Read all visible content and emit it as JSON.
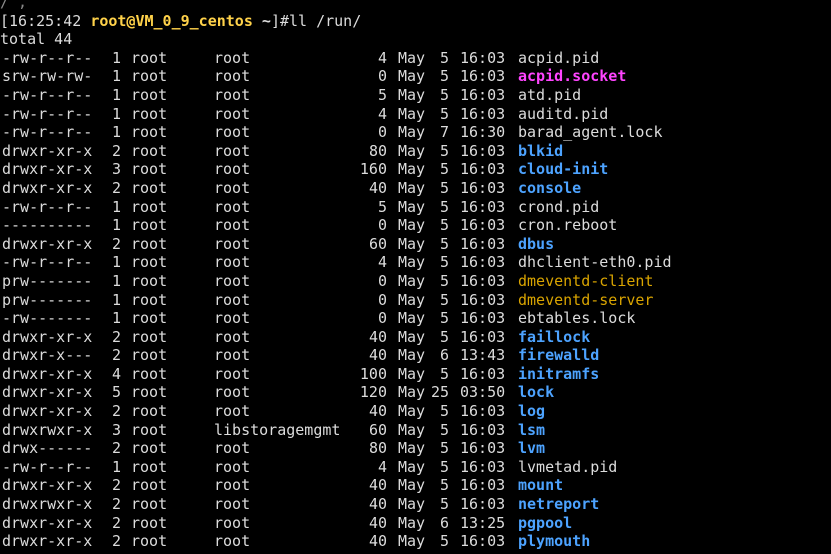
{
  "terminal": {
    "cut_line": "​/ ,",
    "prompt": {
      "open_bracket": "[",
      "time": "16:25:42",
      "user_host": "root@VM_0_9_centos",
      "cwd": " ~",
      "close_bracket": "]",
      "command": "#ll /run/"
    },
    "total_line": "total 44",
    "entries": [
      {
        "perm": "-rw-r--r--",
        "links": "1",
        "owner": "root",
        "group": "root",
        "size": "4",
        "month": "May",
        "day": "5",
        "time": "16:03",
        "name": "acpid.pid",
        "kind": "file"
      },
      {
        "perm": "srw-rw-rw-",
        "links": "1",
        "owner": "root",
        "group": "root",
        "size": "0",
        "month": "May",
        "day": "5",
        "time": "16:03",
        "name": "acpid.socket",
        "kind": "socket"
      },
      {
        "perm": "-rw-r--r--",
        "links": "1",
        "owner": "root",
        "group": "root",
        "size": "5",
        "month": "May",
        "day": "5",
        "time": "16:03",
        "name": "atd.pid",
        "kind": "file"
      },
      {
        "perm": "-rw-r--r--",
        "links": "1",
        "owner": "root",
        "group": "root",
        "size": "4",
        "month": "May",
        "day": "5",
        "time": "16:03",
        "name": "auditd.pid",
        "kind": "file"
      },
      {
        "perm": "-rw-r--r--",
        "links": "1",
        "owner": "root",
        "group": "root",
        "size": "0",
        "month": "May",
        "day": "7",
        "time": "16:30",
        "name": "barad_agent.lock",
        "kind": "file"
      },
      {
        "perm": "drwxr-xr-x",
        "links": "2",
        "owner": "root",
        "group": "root",
        "size": "80",
        "month": "May",
        "day": "5",
        "time": "16:03",
        "name": "blkid",
        "kind": "dir"
      },
      {
        "perm": "drwxr-xr-x",
        "links": "3",
        "owner": "root",
        "group": "root",
        "size": "160",
        "month": "May",
        "day": "5",
        "time": "16:03",
        "name": "cloud-init",
        "kind": "dir"
      },
      {
        "perm": "drwxr-xr-x",
        "links": "2",
        "owner": "root",
        "group": "root",
        "size": "40",
        "month": "May",
        "day": "5",
        "time": "16:03",
        "name": "console",
        "kind": "dir"
      },
      {
        "perm": "-rw-r--r--",
        "links": "1",
        "owner": "root",
        "group": "root",
        "size": "5",
        "month": "May",
        "day": "5",
        "time": "16:03",
        "name": "crond.pid",
        "kind": "file"
      },
      {
        "perm": "----------",
        "links": "1",
        "owner": "root",
        "group": "root",
        "size": "0",
        "month": "May",
        "day": "5",
        "time": "16:03",
        "name": "cron.reboot",
        "kind": "file"
      },
      {
        "perm": "drwxr-xr-x",
        "links": "2",
        "owner": "root",
        "group": "root",
        "size": "60",
        "month": "May",
        "day": "5",
        "time": "16:03",
        "name": "dbus",
        "kind": "dir"
      },
      {
        "perm": "-rw-r--r--",
        "links": "1",
        "owner": "root",
        "group": "root",
        "size": "4",
        "month": "May",
        "day": "5",
        "time": "16:03",
        "name": "dhclient-eth0.pid",
        "kind": "file"
      },
      {
        "perm": "prw-------",
        "links": "1",
        "owner": "root",
        "group": "root",
        "size": "0",
        "month": "May",
        "day": "5",
        "time": "16:03",
        "name": "dmeventd-client",
        "kind": "pipe"
      },
      {
        "perm": "prw-------",
        "links": "1",
        "owner": "root",
        "group": "root",
        "size": "0",
        "month": "May",
        "day": "5",
        "time": "16:03",
        "name": "dmeventd-server",
        "kind": "pipe"
      },
      {
        "perm": "-rw-------",
        "links": "1",
        "owner": "root",
        "group": "root",
        "size": "0",
        "month": "May",
        "day": "5",
        "time": "16:03",
        "name": "ebtables.lock",
        "kind": "file"
      },
      {
        "perm": "drwxr-xr-x",
        "links": "2",
        "owner": "root",
        "group": "root",
        "size": "40",
        "month": "May",
        "day": "5",
        "time": "16:03",
        "name": "faillock",
        "kind": "dir"
      },
      {
        "perm": "drwxr-x---",
        "links": "2",
        "owner": "root",
        "group": "root",
        "size": "40",
        "month": "May",
        "day": "6",
        "time": "13:43",
        "name": "firewalld",
        "kind": "dir"
      },
      {
        "perm": "drwxr-xr-x",
        "links": "4",
        "owner": "root",
        "group": "root",
        "size": "100",
        "month": "May",
        "day": "5",
        "time": "16:03",
        "name": "initramfs",
        "kind": "dir"
      },
      {
        "perm": "drwxr-xr-x",
        "links": "5",
        "owner": "root",
        "group": "root",
        "size": "120",
        "month": "May",
        "day": "25",
        "time": "03:50",
        "name": "lock",
        "kind": "dir"
      },
      {
        "perm": "drwxr-xr-x",
        "links": "2",
        "owner": "root",
        "group": "root",
        "size": "40",
        "month": "May",
        "day": "5",
        "time": "16:03",
        "name": "log",
        "kind": "dir"
      },
      {
        "perm": "drwxrwxr-x",
        "links": "3",
        "owner": "root",
        "group": "libstoragemgmt",
        "size": "60",
        "month": "May",
        "day": "5",
        "time": "16:03",
        "name": "lsm",
        "kind": "dir"
      },
      {
        "perm": "drwx------",
        "links": "2",
        "owner": "root",
        "group": "root",
        "size": "80",
        "month": "May",
        "day": "5",
        "time": "16:03",
        "name": "lvm",
        "kind": "dir"
      },
      {
        "perm": "-rw-r--r--",
        "links": "1",
        "owner": "root",
        "group": "root",
        "size": "4",
        "month": "May",
        "day": "5",
        "time": "16:03",
        "name": "lvmetad.pid",
        "kind": "file"
      },
      {
        "perm": "drwxr-xr-x",
        "links": "2",
        "owner": "root",
        "group": "root",
        "size": "40",
        "month": "May",
        "day": "5",
        "time": "16:03",
        "name": "mount",
        "kind": "dir"
      },
      {
        "perm": "drwxrwxr-x",
        "links": "2",
        "owner": "root",
        "group": "root",
        "size": "40",
        "month": "May",
        "day": "5",
        "time": "16:03",
        "name": "netreport",
        "kind": "dir"
      },
      {
        "perm": "drwxr-xr-x",
        "links": "2",
        "owner": "root",
        "group": "root",
        "size": "40",
        "month": "May",
        "day": "6",
        "time": "13:25",
        "name": "pgpool",
        "kind": "dir"
      },
      {
        "perm": "drwxr-xr-x",
        "links": "2",
        "owner": "root",
        "group": "root",
        "size": "40",
        "month": "May",
        "day": "5",
        "time": "16:03",
        "name": "plymouth",
        "kind": "dir"
      }
    ]
  },
  "colors": {
    "background": "#000000",
    "text": "#dcdcdc",
    "prompt_user": "#ffd24a",
    "directory": "#4da3ff",
    "socket": "#ff44ff",
    "pipe": "#d9a400"
  }
}
